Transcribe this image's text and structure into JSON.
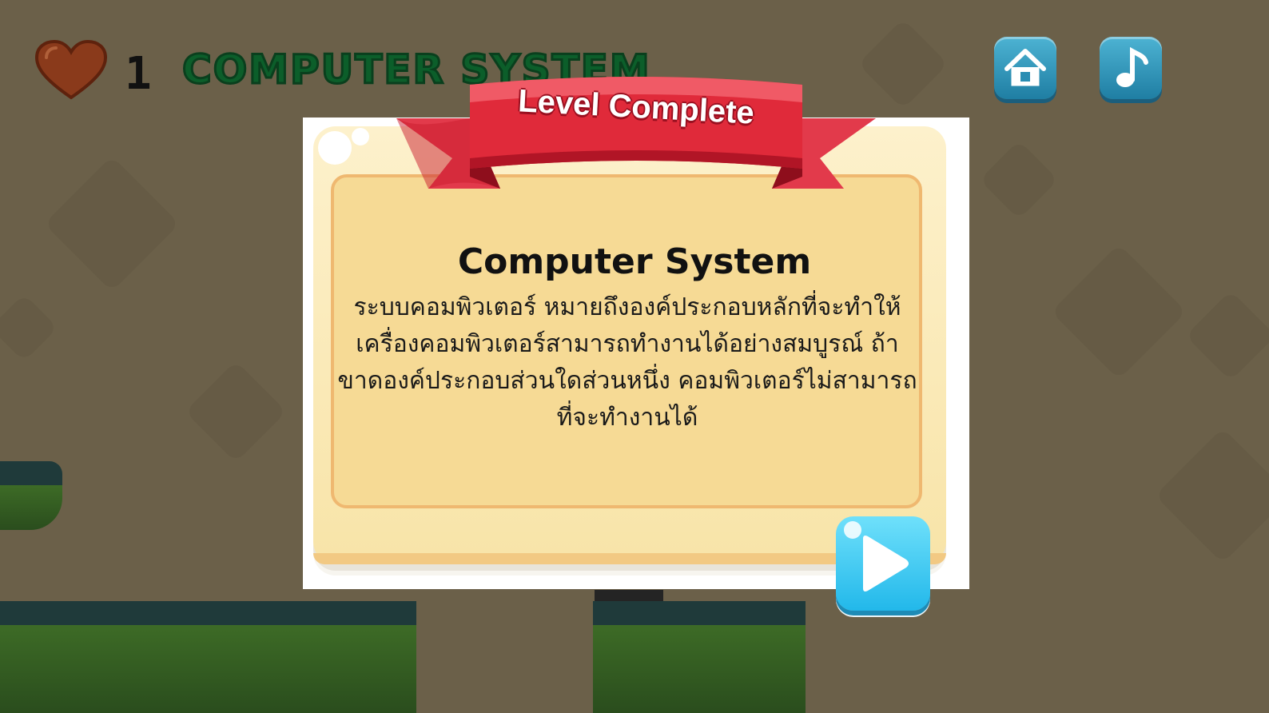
{
  "hud": {
    "lives_icon": "heart-icon",
    "lives_count": "1",
    "level_name": "COMPUTER SYSTEM",
    "home_icon": "home-icon",
    "music_icon": "music-note-icon"
  },
  "modal": {
    "banner_label": "Level Complete",
    "title": "Computer System",
    "description": "ระบบคอมพิวเตอร์ หมายถึงองค์ประกอบหลักที่จะทำให้เครื่องคอมพิวเตอร์สามารถทำงานได้อย่างสมบูรณ์ ถ้าขาดองค์ประกอบส่วนใดส่วนหนึ่ง คอมพิวเตอร์ไม่สามารถที่จะทำงานได้",
    "play_icon": "play-icon"
  },
  "colors": {
    "background": "#6b6049",
    "ribbon": "#e02a3a",
    "accent_blue": "#2fbde9",
    "title_green": "#0c5e2a",
    "heart": "#8a3a1b"
  }
}
